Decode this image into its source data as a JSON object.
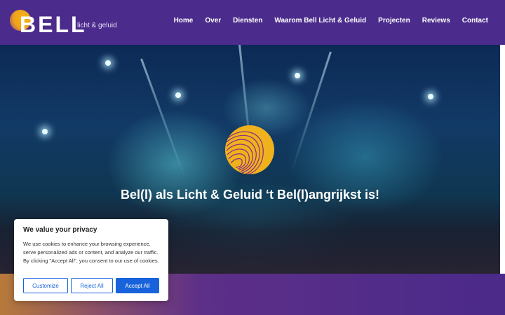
{
  "header": {
    "logo_word": "BELL",
    "logo_sub": "licht & geluid",
    "nav": [
      "Home",
      "Over",
      "Diensten",
      "Waarom Bell Licht & Geluid",
      "Projecten",
      "Reviews",
      "Contact"
    ]
  },
  "hero": {
    "title": "Bel(l) als Licht & Geluid ‘t Bel(l)angrijkst is!"
  },
  "cookie_banner": {
    "title": "We value your privacy",
    "text": "We use cookies to enhance your browsing experience, serve personalized ads or content, and analyze our traffic. By clicking \"Accept All\", you consent to our use of cookies.",
    "customize_label": "Customize",
    "reject_label": "Reject All",
    "accept_label": "Accept All"
  },
  "colors": {
    "header_bg": "#4b2c8c",
    "accent_yellow": "#f0b21c",
    "button_blue": "#1863dc"
  }
}
